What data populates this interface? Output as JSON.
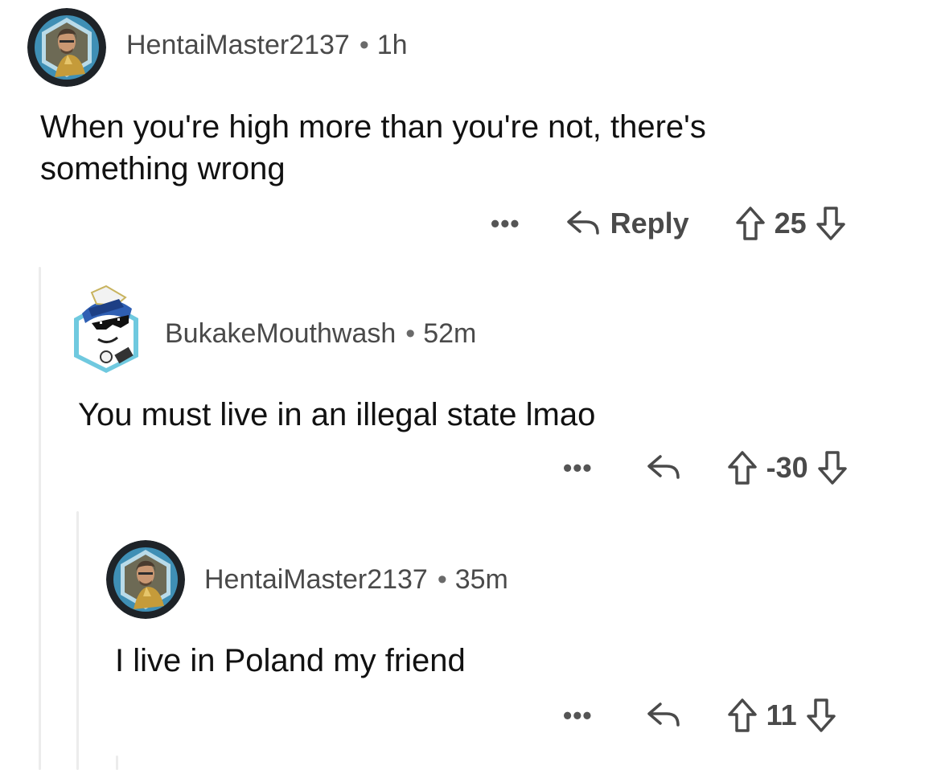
{
  "comments": [
    {
      "username": "HentaiMaster2137",
      "separator": "•",
      "time": "1h",
      "body": "When you're high more than you're not, there's something wrong",
      "more": "•••",
      "reply_label": "Reply",
      "score": "25",
      "avatar_icon": "snake-character-avatar",
      "ring_color": "#1e2328"
    },
    {
      "username": "BukakeMouthwash",
      "separator": "•",
      "time": "52m",
      "body": "You must live in an illegal state lmao",
      "more": "•••",
      "score": "-30",
      "avatar_icon": "sunglasses-snoo-avatar",
      "ring_color": "#6fc9df"
    },
    {
      "username": "HentaiMaster2137",
      "separator": "•",
      "time": "35m",
      "body": "I live in Poland my friend",
      "more": "•••",
      "score": "11",
      "avatar_icon": "snake-character-avatar",
      "ring_color": "#1e2328"
    }
  ],
  "colors": {
    "text": "#111111",
    "meta": "#4a4a4a",
    "thread_line": "#ececec"
  }
}
